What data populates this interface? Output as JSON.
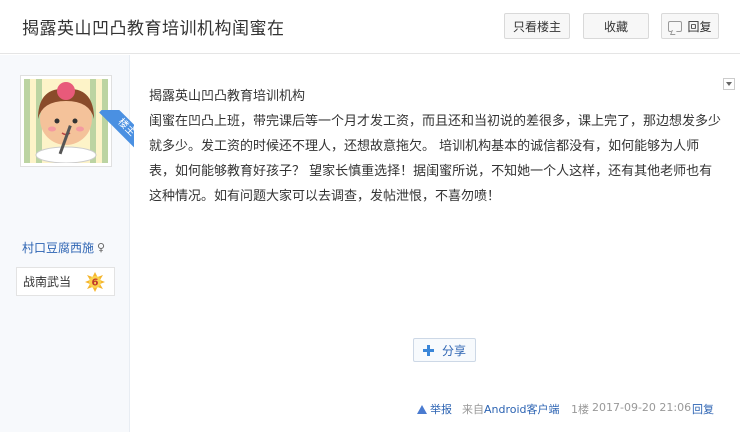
{
  "header": {
    "title": "揭露英山凹凸教育培训机构闺蜜在",
    "only_op_label": "只看楼主",
    "favorite_label": "收藏",
    "reply_label": "回复"
  },
  "sidebar": {
    "op_badge": "楼主",
    "username": "村口豆腐西施",
    "gender_icon": "female-icon",
    "level_title": "战南武当",
    "level_number": "6"
  },
  "post": {
    "paragraphs": [
      "揭露英山凹凸教育培训机构",
      "闺蜜在凹凸上班，带完课后等一个月才发工资，而且还和当初说的差很多，课上完了，那边想发多少就多少。发工资的时候还不理人，还想故意拖欠。 培训机构基本的诚信都没有，如何能够为人师表，如何能够教育好孩子？ 望家长慎重选择！据闺蜜所说，不知她一个人这样，还有其他老师也有这种情况。如有问题大家可以去调查，发帖泄恨，不喜勿喷！"
    ],
    "share_label": "分享",
    "report_label": "举报",
    "from_prefix": "来自",
    "from_client": "Android客户端",
    "floor": "1楼",
    "time": "2017-09-20 21:06",
    "reply_label": "回复"
  },
  "colors": {
    "link": "#2d64b3",
    "accent": "#4a90e2",
    "sidebar_bg": "#f7f9fc"
  }
}
